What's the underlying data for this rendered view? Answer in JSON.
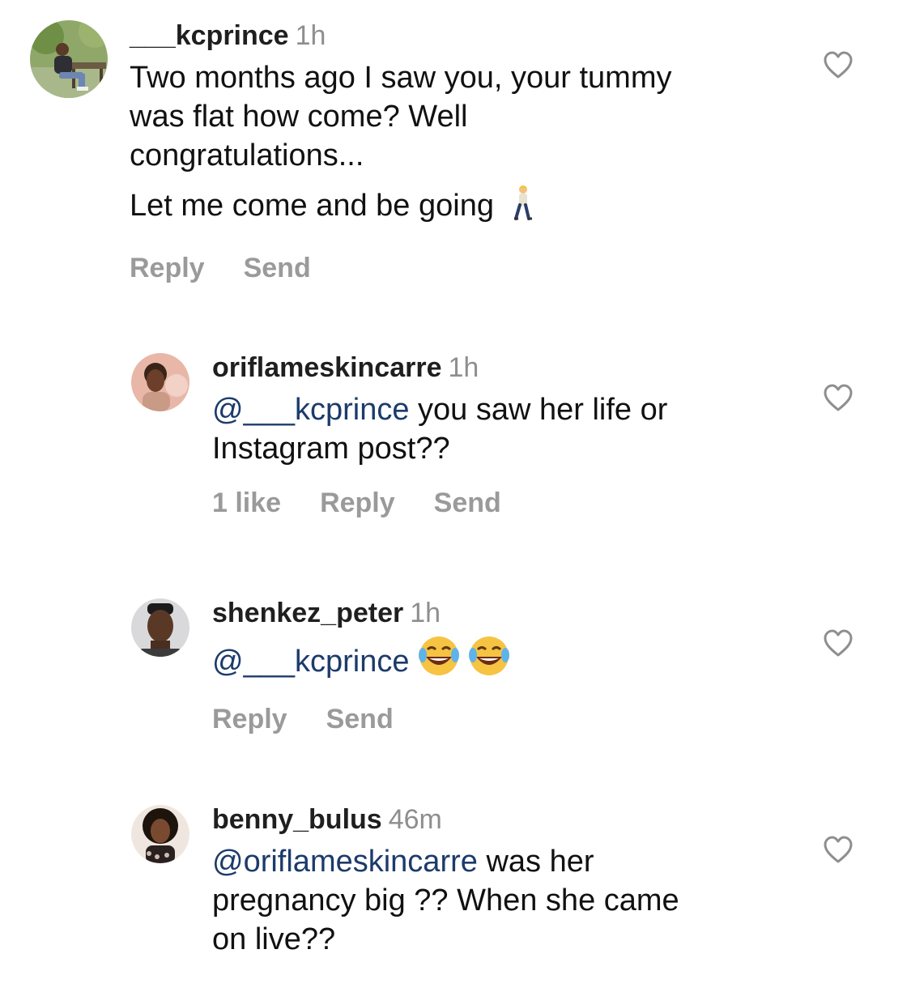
{
  "comments": [
    {
      "username": "___kcprince",
      "time": "1h",
      "lines": [
        "Two months ago I saw you, your tummy",
        "was flat how come? Well",
        "congratulations..."
      ],
      "line2": "Let me come and be going",
      "line2_emoji": "person-walking-emoji",
      "actions": {
        "reply": "Reply",
        "send": "Send"
      }
    },
    {
      "username": "oriflameskincarre",
      "time": "1h",
      "mention": "@___kcprince",
      "text_after_mention": " you saw her life or",
      "text_line2": "Instagram post??",
      "actions": {
        "likes": "1 like",
        "reply": "Reply",
        "send": "Send"
      }
    },
    {
      "username": "shenkez_peter",
      "time": "1h",
      "mention": "@___kcprince",
      "emoji": "face-with-tears-of-joy-emoji",
      "actions": {
        "reply": "Reply",
        "send": "Send"
      }
    },
    {
      "username": "benny_bulus",
      "time": "46m",
      "mention": "@oriflameskincarre",
      "text_after_mention": " was her",
      "text_line2": "pregnancy big ?? When she came",
      "text_line3": "on live??"
    }
  ],
  "colors": {
    "mention": "#1c3b6b",
    "muted": "#8e8e8e",
    "actions": "#9a9a9a"
  }
}
